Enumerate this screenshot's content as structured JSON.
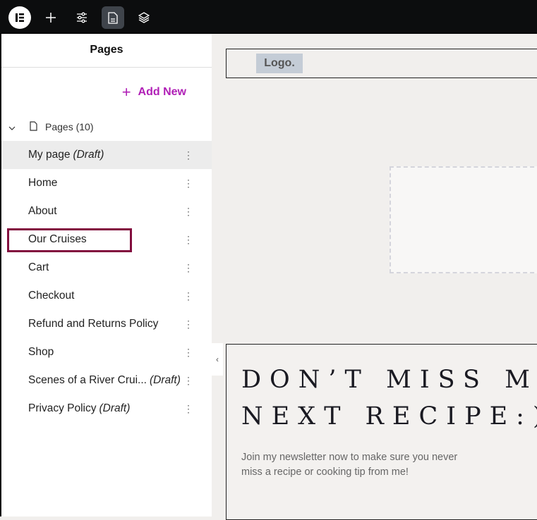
{
  "topbar": {
    "icons": [
      "elementor-logo-icon",
      "plus-icon",
      "sliders-icon",
      "page-icon",
      "layers-icon"
    ]
  },
  "panel": {
    "title": "Pages",
    "add_new": "Add New",
    "group_label": "Pages (10)",
    "items": [
      {
        "label": "My page",
        "draft": "(Draft)"
      },
      {
        "label": "Home",
        "draft": ""
      },
      {
        "label": "About",
        "draft": ""
      },
      {
        "label": "Our Cruises",
        "draft": ""
      },
      {
        "label": "Cart",
        "draft": ""
      },
      {
        "label": "Checkout",
        "draft": ""
      },
      {
        "label": "Refund and Returns Policy",
        "draft": ""
      },
      {
        "label": "Shop",
        "draft": ""
      },
      {
        "label": "Scenes of a River Crui...",
        "draft": "(Draft)"
      },
      {
        "label": "Privacy Policy",
        "draft": "(Draft)"
      }
    ]
  },
  "canvas": {
    "logo": "Logo.",
    "heading": "DON’T MISS MY NEXT RECIPE:)",
    "text": "Join my newsletter now to make sure you never miss a recipe or cooking tip from me!"
  },
  "colors": {
    "accent": "#b01fb6",
    "highlight": "#820c3e"
  }
}
